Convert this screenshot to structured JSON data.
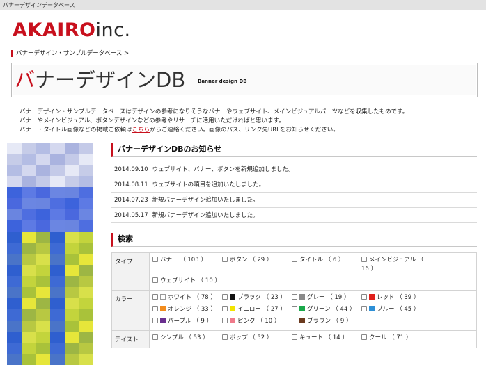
{
  "window": {
    "title": "バナーデザインデータベース"
  },
  "logo": {
    "brand_red": "AKAIRO",
    "brand_dark": "inc."
  },
  "breadcrumb": {
    "text": "バナーデザイン・サンプルデータベース >"
  },
  "header": {
    "title_red": "バ",
    "title_rest": "ナーデザインDB",
    "subtitle": "Banner design DB"
  },
  "intro": {
    "line1": "バナーデザイン・サンプルデータベースはデザインの参考になりそうなバナーやウェブサイト、メインビジュアルパーツなどを収集したものです。",
    "line2": "バナーやメインビジュアル、ボタンデザインなどの参考やリサーチに活用いただければと思います。",
    "line3_pre": "バナー・タイトル画像などの掲載ご依頼は",
    "line3_link": "こちら",
    "line3_post": "からご連絡ください。画像のパス、リンク先URLをお知らせください。"
  },
  "news": {
    "heading": "バナーデザインDBのお知らせ",
    "items": [
      {
        "date": "2014.09.10",
        "text": "ウェブサイト、バナー、ボタンを新規追加しました。"
      },
      {
        "date": "2014.08.11",
        "text": "ウェブサイトの項目を追加いたしました。"
      },
      {
        "date": "2014.07.23",
        "text": "新規バナーデザイン追加いたしました。"
      },
      {
        "date": "2014.05.17",
        "text": "新規バナーデザイン追加いたしました。"
      }
    ]
  },
  "search": {
    "heading": "検索",
    "type": {
      "label": "タイプ",
      "options": [
        "バナー （ 103 ）",
        "ボタン （ 29 ）",
        "タイトル （ 6 ）",
        "メインビジュアル （ 16 ）",
        "ウェブサイト （ 10 ）"
      ]
    },
    "color": {
      "label": "カラー",
      "options": [
        {
          "text": "ホワイト （ 78 ）",
          "swatch": "#ffffff"
        },
        {
          "text": "ブラック （ 23 ）",
          "swatch": "#111111"
        },
        {
          "text": "グレー （ 19 ）",
          "swatch": "#8a8a8a"
        },
        {
          "text": "レッド （ 39 ）",
          "swatch": "#e0201c"
        },
        {
          "text": "オレンジ （ 33 ）",
          "swatch": "#f28c1e"
        },
        {
          "text": "イエロー （ 27 ）",
          "swatch": "#f2e400"
        },
        {
          "text": "グリーン （ 44 ）",
          "swatch": "#1aa84a"
        },
        {
          "text": "ブルー （ 45 ）",
          "swatch": "#2d8fd6"
        },
        {
          "text": "パープル （ 9 ）",
          "swatch": "#6a2f8f"
        },
        {
          "text": "ピンク （ 10 ）",
          "swatch": "#ef7a8a"
        },
        {
          "text": "ブラウン （ 9 ）",
          "swatch": "#6b3a1f"
        }
      ]
    },
    "taste": {
      "label": "テイスト",
      "options": [
        "シンプル （ 53 ）",
        "ポップ （ 52 ）",
        "キュート （ 14 ）",
        "クール （ 71 ）"
      ]
    }
  },
  "colors": {
    "accent": "#c8101d"
  }
}
